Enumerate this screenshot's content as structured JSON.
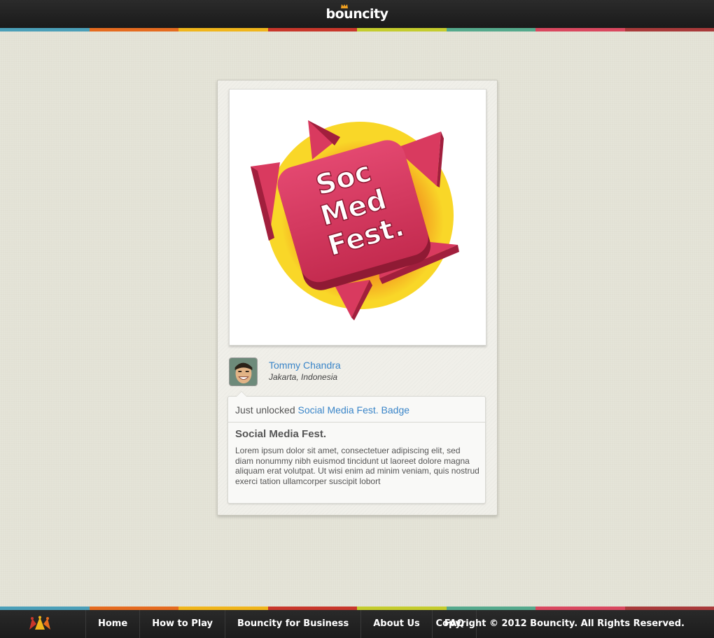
{
  "header": {
    "logo_text": "bouncity"
  },
  "stripe_colors": [
    "#4b9fb8",
    "#e56b1f",
    "#f0b51b",
    "#c8372b",
    "#c4cc2d",
    "#55a98c",
    "#d9485f",
    "#a83a3a"
  ],
  "badge": {
    "lines": [
      "Soc",
      "Med",
      "Fest."
    ],
    "colors": {
      "magenta": "#d93a5f",
      "dark_magenta": "#a11f3d",
      "yellow": "#f9d728",
      "orange": "#f39b1f"
    }
  },
  "user": {
    "name": "Tommy Chandra",
    "location": "Jakarta, Indonesia"
  },
  "activity": {
    "prefix": "Just unlocked",
    "badge_link": "Social Media Fest. Badge",
    "title": "Social Media Fest.",
    "description": "Lorem ipsum dolor sit amet, consectetuer adipiscing elit, sed diam nonummy nibh euismod tincidunt ut laoreet dolore magna aliquam erat volutpat. Ut wisi enim ad minim veniam, quis nostrud exerci tation ullamcorper suscipit lobort"
  },
  "footer": {
    "nav": [
      "Home",
      "How to Play",
      "Bouncity for Business",
      "About Us",
      "FAQ"
    ],
    "copyright": "Copyright © 2012 Bouncity. All Rights Reserved."
  },
  "colors": {
    "link": "#3a85c8",
    "text": "#555555"
  }
}
